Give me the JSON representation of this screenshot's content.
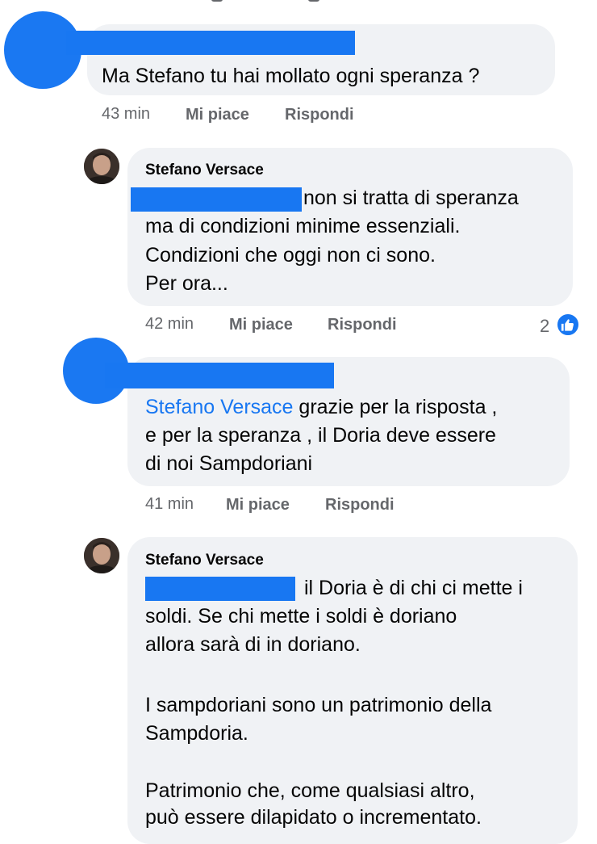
{
  "comments": [
    {
      "text": "Ma Stefano tu hai mollato ogni speranza ?",
      "time": "43 min",
      "like": "Mi piace",
      "reply": "Rispondi"
    },
    {
      "author": "Stefano Versace",
      "lines": [
        "non si tratta di speranza",
        "ma di condizioni minime essenziali.",
        "Condizioni che oggi non ci sono.",
        "Per ora..."
      ],
      "time": "42 min",
      "like": "Mi piace",
      "reply": "Rispondi",
      "reactions": "2"
    },
    {
      "mention": "Stefano Versace",
      "lines": [
        " grazie per la risposta ,",
        "e per la speranza , il Doria deve essere",
        "di noi Sampdoriani"
      ],
      "time": "41 min",
      "like": "Mi piace",
      "reply": "Rispondi"
    },
    {
      "author": "Stefano Versace",
      "lines": [
        "il Doria è di chi ci mette i",
        "soldi. Se chi mette i soldi è doriano",
        "allora sarà di in doriano.",
        "",
        "I sampdoriani sono un patrimonio della",
        "Sampdoria.",
        "",
        "Patrimonio che, come qualsiasi altro,",
        "può essere dilapidato o incrementato."
      ]
    }
  ],
  "colors": {
    "redaction": "#1877f2",
    "bubble": "#f0f2f5",
    "meta": "#65676b",
    "like_badge": "#1877f2"
  },
  "icons": [
    "like-reaction-icon"
  ]
}
